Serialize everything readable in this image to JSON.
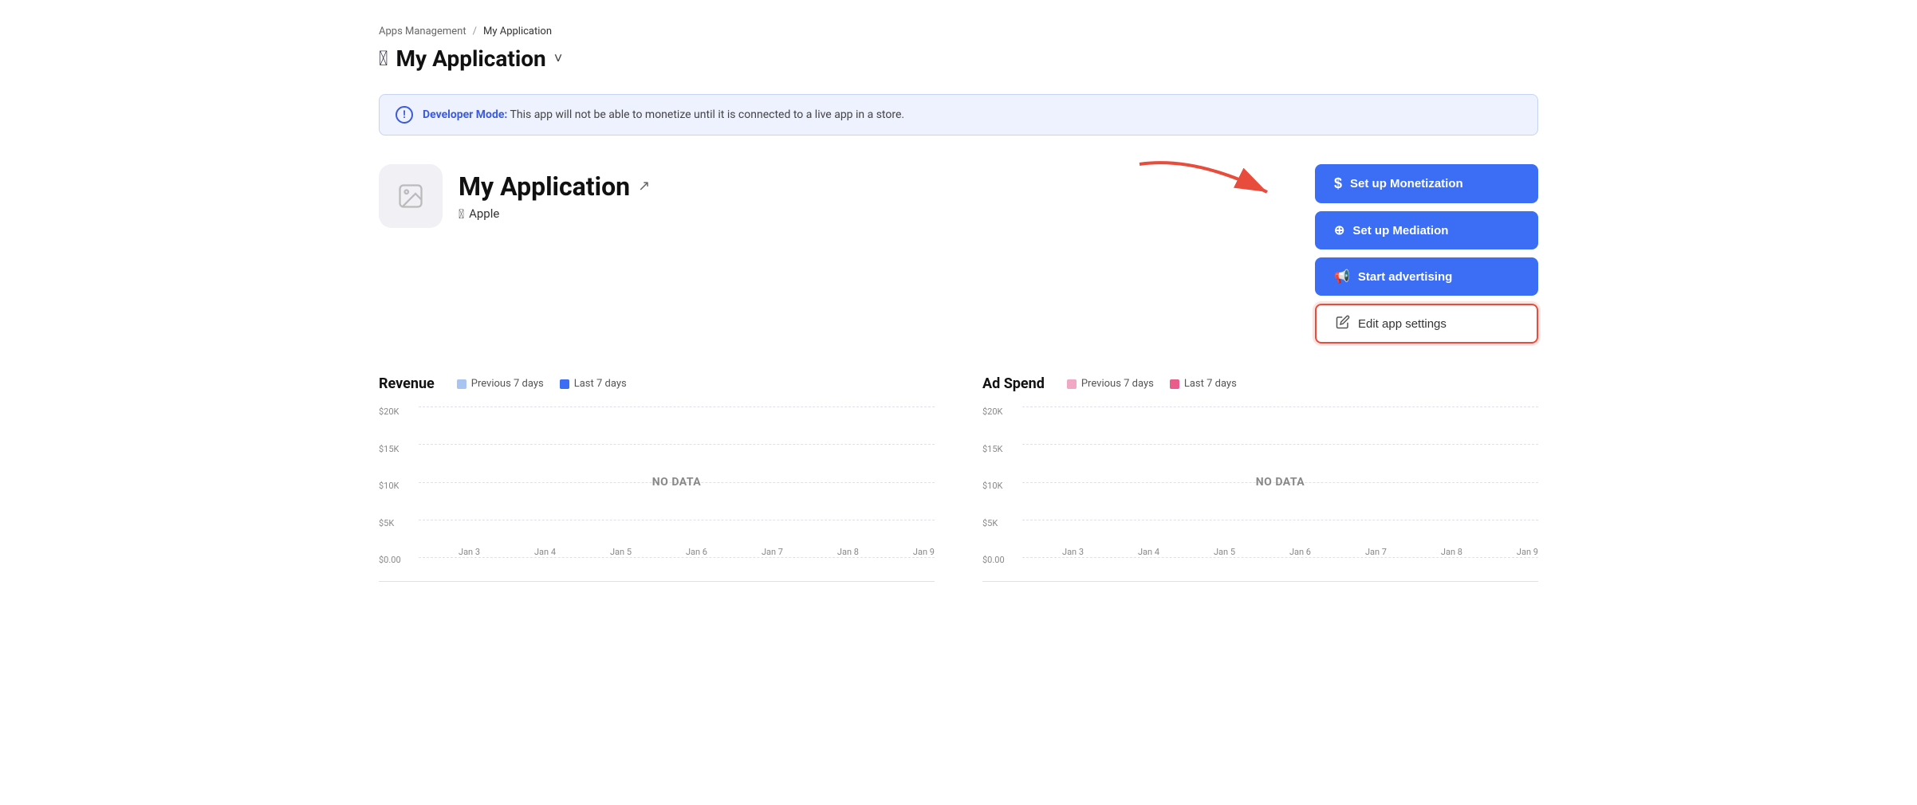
{
  "breadcrumb": {
    "parent": "Apps Management",
    "separator": "/",
    "current": "My Application"
  },
  "page_title": {
    "logo": "🍎",
    "text": "My Application",
    "chevron": "˅"
  },
  "banner": {
    "label": "Developer Mode:",
    "message": " This app will not be able to monetize until it is connected to a live app in a store."
  },
  "app": {
    "name": "My Application",
    "platform": "Apple"
  },
  "buttons": {
    "setup_monetization": "Set up Monetization",
    "setup_mediation": "Set up Mediation",
    "start_advertising": "Start advertising",
    "edit_settings": "Edit app settings"
  },
  "revenue_chart": {
    "title": "Revenue",
    "legend": [
      {
        "label": "Previous 7 days",
        "color": "#a8c4f0"
      },
      {
        "label": "Last 7 days",
        "color": "#3b6ef5"
      }
    ],
    "y_labels": [
      "$20K",
      "$15K",
      "$10K",
      "$5K",
      "$0.00"
    ],
    "x_labels": [
      "Jan 3",
      "Jan 4",
      "Jan 5",
      "Jan 6",
      "Jan 7",
      "Jan 8",
      "Jan 9"
    ],
    "no_data": "NO DATA"
  },
  "adspend_chart": {
    "title": "Ad Spend",
    "legend": [
      {
        "label": "Previous 7 days",
        "color": "#f0a8c4"
      },
      {
        "label": "Last 7 days",
        "color": "#e85d8a"
      }
    ],
    "y_labels": [
      "$20K",
      "$15K",
      "$10K",
      "$5K",
      "$0.00"
    ],
    "x_labels": [
      "Jan 3",
      "Jan 4",
      "Jan 5",
      "Jan 6",
      "Jan 7",
      "Jan 8",
      "Jan 9"
    ],
    "no_data": "NO DATA"
  }
}
